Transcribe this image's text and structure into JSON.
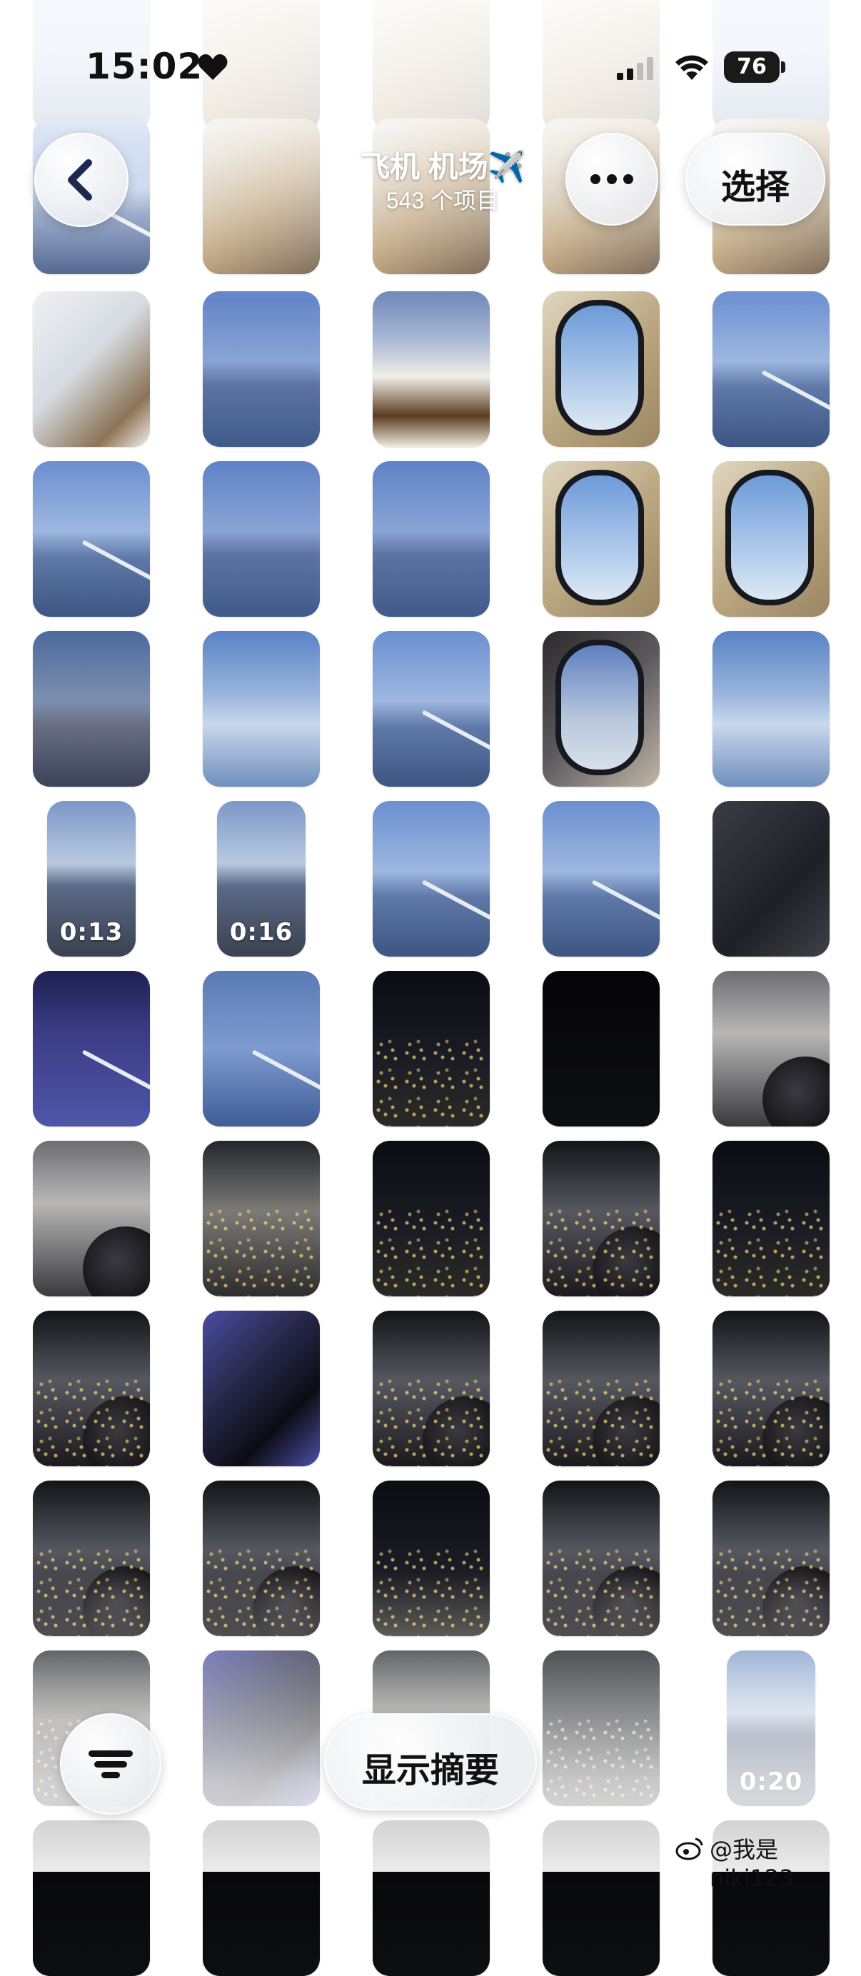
{
  "status_bar": {
    "time": "15:02",
    "battery": "76"
  },
  "header": {
    "title": "飞机 机场✈️",
    "subtitle": "543 个项目",
    "select_label": "选择"
  },
  "bottom": {
    "summary_label": "显示摘要"
  },
  "watermark": "@我是niki123",
  "thumbnails": [
    {
      "style": "sky"
    },
    {
      "style": "meal"
    },
    {
      "style": "meal"
    },
    {
      "style": "meal"
    },
    {
      "style": "sky"
    },
    {
      "style": "sky-wing"
    },
    {
      "style": "meal"
    },
    {
      "style": "meal"
    },
    {
      "style": "meal"
    },
    {
      "style": "meal"
    },
    {
      "style": "cabin"
    },
    {
      "style": "sky-blue"
    },
    {
      "style": "meal-rice"
    },
    {
      "style": "window"
    },
    {
      "style": "sky-wing"
    },
    {
      "style": "sky-wing"
    },
    {
      "style": "sky-blue"
    },
    {
      "style": "sky-blue"
    },
    {
      "style": "window"
    },
    {
      "style": "window"
    },
    {
      "style": "sky-dusk"
    },
    {
      "style": "clouds"
    },
    {
      "style": "sky-wing"
    },
    {
      "style": "window-dark"
    },
    {
      "style": "clouds"
    },
    {
      "style": "video",
      "duration": "0:13"
    },
    {
      "style": "video",
      "duration": "0:16"
    },
    {
      "style": "sky-wing"
    },
    {
      "style": "sky-wing"
    },
    {
      "style": "dark-frame"
    },
    {
      "style": "purple-wing"
    },
    {
      "style": "blue-wing"
    },
    {
      "style": "night"
    },
    {
      "style": "black"
    },
    {
      "style": "engine-grey"
    },
    {
      "style": "engine-grey"
    },
    {
      "style": "night-clouds"
    },
    {
      "style": "night"
    },
    {
      "style": "night-engine"
    },
    {
      "style": "night"
    },
    {
      "style": "night-engine"
    },
    {
      "style": "purple-window"
    },
    {
      "style": "night-engine"
    },
    {
      "style": "night-engine"
    },
    {
      "style": "night-engine"
    },
    {
      "style": "night-engine"
    },
    {
      "style": "night-engine"
    },
    {
      "style": "night"
    },
    {
      "style": "night-engine"
    },
    {
      "style": "night-engine"
    },
    {
      "style": "night-clouds"
    },
    {
      "style": "purple-window"
    },
    {
      "style": "night-clouds"
    },
    {
      "style": "night"
    },
    {
      "style": "video",
      "duration": "0:20"
    },
    {
      "style": "black"
    },
    {
      "style": "black"
    },
    {
      "style": "black"
    },
    {
      "style": "black"
    },
    {
      "style": "black"
    }
  ]
}
